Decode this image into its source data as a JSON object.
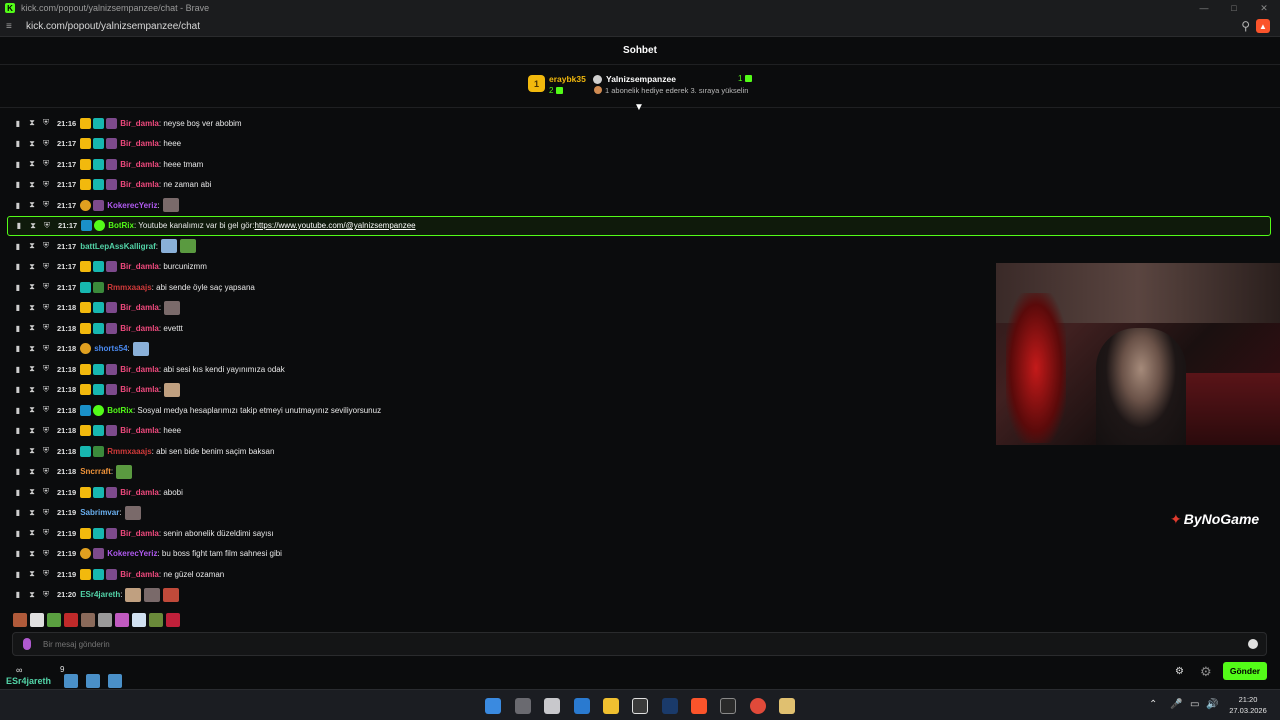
{
  "browser": {
    "window_title": "kick.com/popout/yalnizsempanzee/chat - Brave",
    "url": "kick.com/popout/yalnizsempanzee/chat",
    "favicon_letter": "K"
  },
  "chat": {
    "title": "Sohbet",
    "leaderboard": {
      "rank": "1",
      "top_user": "eraybk35",
      "top_user_count": "2",
      "channel": "Yalnizsempanzee",
      "channel_count": "1",
      "sub_message": "1 abonelik hediye ederek 3. sıraya yükselin"
    },
    "messages": [
      {
        "time": "21:16",
        "badges": [
          "crown",
          "vip",
          "sub"
        ],
        "user": "Bir_damla",
        "color": "#f04a7e",
        "text": ": neyse boş ver abobim",
        "emotes": 0
      },
      {
        "time": "21:17",
        "badges": [
          "crown",
          "vip",
          "sub"
        ],
        "user": "Bir_damla",
        "color": "#f04a7e",
        "text": ": heee",
        "emotes": 0
      },
      {
        "time": "21:17",
        "badges": [
          "crown",
          "vip",
          "sub"
        ],
        "user": "Bir_damla",
        "color": "#f04a7e",
        "text": ": heee tmam",
        "emotes": 0
      },
      {
        "time": "21:17",
        "badges": [
          "crown",
          "vip",
          "sub"
        ],
        "user": "Bir_damla",
        "color": "#f04a7e",
        "text": ": ne zaman abi",
        "emotes": 0
      },
      {
        "time": "21:17",
        "badges": [
          "og",
          "sub"
        ],
        "user": "KokerecYeriz",
        "color": "#b05af0",
        "text": ":",
        "emotes": 1
      },
      {
        "time": "21:17",
        "badges": [
          "bot",
          "check"
        ],
        "user": "BotRix",
        "color": "#53fc18",
        "text": ": Youtube kanalımız var bi gel gör: ",
        "link": "https://www.youtube.com/@yalnizsempanzee",
        "highlight": true,
        "emotes": 0
      },
      {
        "time": "21:17",
        "badges": [],
        "user": "battLepAssKalligraf",
        "color": "#53d4a8",
        "text": ":",
        "emotes": 2
      },
      {
        "time": "21:17",
        "badges": [
          "crown",
          "vip",
          "sub"
        ],
        "user": "Bir_damla",
        "color": "#f04a7e",
        "text": ": burcunizmm",
        "emotes": 0
      },
      {
        "time": "21:17",
        "badges": [
          "vip",
          "mod"
        ],
        "user": "Rmmxaaajs",
        "color": "#d03a3a",
        "text": ": abi sende öyle saç yapsana",
        "emotes": 0
      },
      {
        "time": "21:18",
        "badges": [
          "crown",
          "vip",
          "sub"
        ],
        "user": "Bir_damla",
        "color": "#f04a7e",
        "text": ":",
        "emotes": 1
      },
      {
        "time": "21:18",
        "badges": [
          "crown",
          "vip",
          "sub"
        ],
        "user": "Bir_damla",
        "color": "#f04a7e",
        "text": ": evettt",
        "emotes": 0
      },
      {
        "time": "21:18",
        "badges": [
          "og"
        ],
        "user": "shorts54",
        "color": "#4a8af0",
        "text": ":",
        "emotes": 1
      },
      {
        "time": "21:18",
        "badges": [
          "crown",
          "vip",
          "sub"
        ],
        "user": "Bir_damla",
        "color": "#f04a7e",
        "text": ": abi sesi kıs kendi yayınımıza odak",
        "emotes": 0
      },
      {
        "time": "21:18",
        "badges": [
          "crown",
          "vip",
          "sub"
        ],
        "user": "Bir_damla",
        "color": "#f04a7e",
        "text": ":",
        "emotes": 1
      },
      {
        "time": "21:18",
        "badges": [
          "bot",
          "check"
        ],
        "user": "BotRix",
        "color": "#53fc18",
        "text": ": Sosyal medya hesaplarımızı takip etmeyi unutmayınız seviliyorsunuz",
        "emotes": 0
      },
      {
        "time": "21:18",
        "badges": [
          "crown",
          "vip",
          "sub"
        ],
        "user": "Bir_damla",
        "color": "#f04a7e",
        "text": ": heee",
        "emotes": 0
      },
      {
        "time": "21:18",
        "badges": [
          "vip",
          "mod"
        ],
        "user": "Rmmxaaajs",
        "color": "#d03a3a",
        "text": ": abi sen bide benim saçim baksan",
        "emotes": 0
      },
      {
        "time": "21:18",
        "badges": [],
        "user": "Sncrraft",
        "color": "#f0943a",
        "text": ":",
        "emotes": 1
      },
      {
        "time": "21:19",
        "badges": [
          "crown",
          "vip",
          "sub"
        ],
        "user": "Bir_damla",
        "color": "#f04a7e",
        "text": ": abobi",
        "emotes": 0
      },
      {
        "time": "21:19",
        "badges": [],
        "user": "Sabrimvar",
        "color": "#6ab0f0",
        "text": ":",
        "emotes": 1
      },
      {
        "time": "21:19",
        "badges": [
          "crown",
          "vip",
          "sub"
        ],
        "user": "Bir_damla",
        "color": "#f04a7e",
        "text": ": senin abonelik düzeldimi sayısı",
        "emotes": 0
      },
      {
        "time": "21:19",
        "badges": [
          "og",
          "sub"
        ],
        "user": "KokerecYeriz",
        "color": "#b05af0",
        "text": ": bu boss fight tam film sahnesi gibi",
        "emotes": 0
      },
      {
        "time": "21:19",
        "badges": [
          "crown",
          "vip",
          "sub"
        ],
        "user": "Bir_damla",
        "color": "#f04a7e",
        "text": ": ne güzel ozaman",
        "emotes": 0
      },
      {
        "time": "21:20",
        "badges": [],
        "user": "ESr4jareth",
        "color": "#53d4a8",
        "text": ":",
        "emotes": 3
      }
    ],
    "input_placeholder": "Bir mesaj gönderin",
    "send_label": "Gönder",
    "bottom_user": "ESr4jareth",
    "bottom_icons": "∞",
    "bottom_count": "9",
    "watermark": "ByNoGame"
  },
  "taskbar": {
    "time": "21:20",
    "date": "27.03.2026"
  },
  "colors": {
    "accent": "#53fc18",
    "background": "#0b0c0d",
    "gold": "#f2b90d"
  }
}
